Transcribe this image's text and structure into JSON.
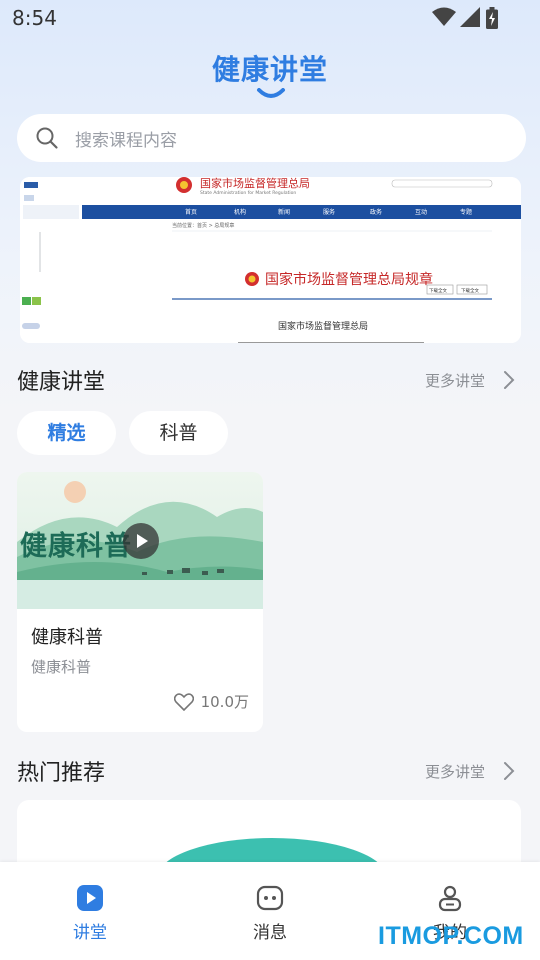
{
  "status_bar": {
    "time": "8:54"
  },
  "header": {
    "title": "健康讲堂"
  },
  "search": {
    "placeholder": "搜索课程内容"
  },
  "banner": {
    "header_title": "国家市场监督管理总局",
    "header_subtitle": "State Administration for Market Regulation",
    "nav_items": [
      "首页",
      "机构",
      "新闻",
      "服务",
      "政务",
      "互动",
      "专题"
    ],
    "breadcrumb": "当前位置：首页 > 总局规章",
    "section_title": "国家市场监督管理总局规章",
    "button_1": "下载全文",
    "button_2": "下载全文",
    "issuer": "国家市场监督管理总局"
  },
  "lecture_section": {
    "title": "健康讲堂",
    "more": "更多讲堂"
  },
  "tabs": [
    {
      "label": "精选",
      "active": true
    },
    {
      "label": "科普",
      "active": false
    }
  ],
  "course_card": {
    "thumb_text": "健康科普",
    "title": "健康科普",
    "subtitle": "健康科普",
    "likes": "10.0万"
  },
  "hot_section": {
    "title": "热门推荐",
    "more": "更多讲堂"
  },
  "tabbar": [
    {
      "label": "讲堂",
      "icon": "play-icon",
      "active": true
    },
    {
      "label": "消息",
      "icon": "message-icon",
      "active": false
    },
    {
      "label": "我的",
      "icon": "profile-icon",
      "active": false
    }
  ],
  "watermark": "ITMOP.COM",
  "colors": {
    "accent": "#2f7de1",
    "page_bg": "#f4f5f8",
    "watermark": "#1a9be0"
  }
}
